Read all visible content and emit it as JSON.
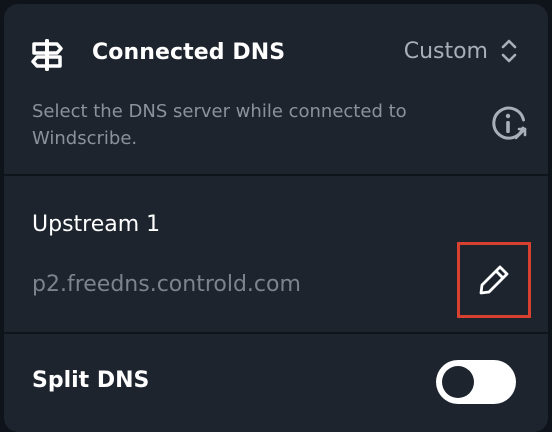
{
  "header": {
    "title": "Connected DNS",
    "mode_value": "Custom",
    "description": "Select the DNS server while connected to Windscribe."
  },
  "icons": {
    "dns": "dns-signpost-icon",
    "selector": "chevron-updown-icon",
    "info": "info-external-icon",
    "edit": "pencil-icon"
  },
  "upstream": {
    "label": "Upstream 1",
    "value": "p2.freedns.controld.com"
  },
  "split_dns": {
    "label": "Split DNS",
    "enabled": false
  },
  "colors": {
    "panel_bg": "#1d242e",
    "highlight_border": "#d8402f",
    "toggle_track": "#ffffff"
  }
}
